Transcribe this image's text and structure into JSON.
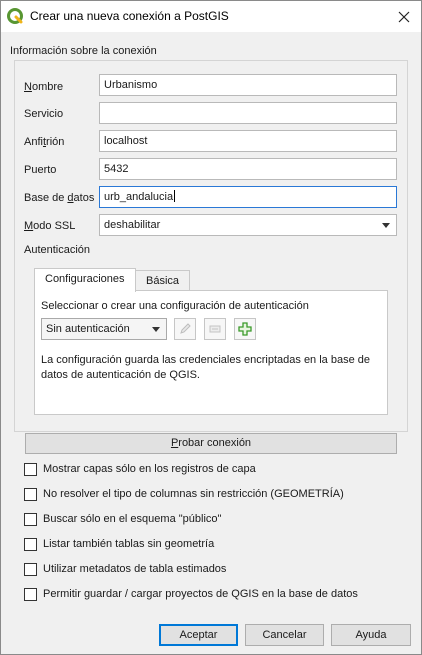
{
  "window": {
    "title": "Crear una nueva conexión a PostGIS"
  },
  "connection_group": {
    "title": "Información sobre la conexión",
    "fields": {
      "name": {
        "label": "Nombre",
        "value": "Urbanismo"
      },
      "service": {
        "label": "Servicio",
        "value": ""
      },
      "host": {
        "label": "Anfitrión",
        "value": "localhost"
      },
      "port": {
        "label": "Puerto",
        "value": "5432"
      },
      "database": {
        "label": "Base de datos",
        "value": "urb_andalucia"
      },
      "ssl_mode": {
        "label": "Modo SSL",
        "value": "deshabilitar"
      }
    }
  },
  "authentication": {
    "title": "Autenticación",
    "tabs": [
      "Configuraciones",
      "Básica"
    ],
    "select_text": "Seleccionar o crear una configuración de autenticación",
    "config_selected": "Sin autenticación",
    "info_text_line1": "La configuración guarda las credenciales encriptadas en la base de",
    "info_text_line2": "datos de autenticación de QGIS."
  },
  "test_button": "Probar conexión",
  "options": [
    "Mostrar capas sólo en los registros de capa",
    "No resolver el tipo de columnas sin restricción (GEOMETRÍA)",
    "Buscar sólo en el esquema \"público\"",
    "Listar también tablas sin geometría",
    "Utilizar metadatos de tabla estimados",
    "Permitir guardar / cargar proyectos de QGIS en la base de datos"
  ],
  "buttons": {
    "ok": "Aceptar",
    "cancel": "Cancelar",
    "help": "Ayuda"
  },
  "icons": {
    "app": "qgis-logo-icon",
    "close": "close-icon",
    "edit": "pencil-icon",
    "clear": "clear-config-icon",
    "add": "add-config-icon"
  },
  "colors": {
    "focus_border": "#2a78d6",
    "qgis_green": "#589632",
    "add_green": "#3a9a2a"
  }
}
